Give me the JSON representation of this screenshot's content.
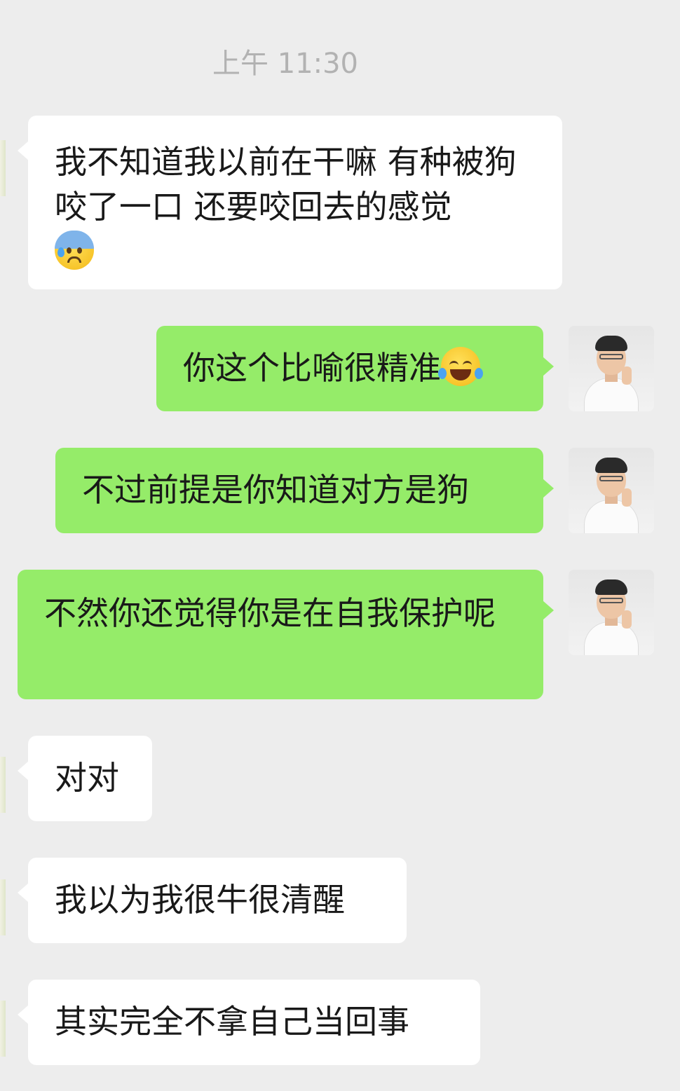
{
  "chat": {
    "timestamp": "上午 11:30",
    "messages": [
      {
        "side": "in",
        "text": "我不知道我以前在干嘛 有种被狗咬了一口 还要咬回去的感觉",
        "emoji": "anxious-face-with-sweat"
      },
      {
        "side": "out",
        "text": "你这个比喻很精准",
        "emoji": "face-with-tears-of-joy"
      },
      {
        "side": "out",
        "text": "不过前提是你知道对方是狗"
      },
      {
        "side": "out",
        "text": "不然你还觉得你是在自我保护呢"
      },
      {
        "side": "in",
        "text": "对对"
      },
      {
        "side": "in",
        "text": "我以为我很牛很清醒"
      },
      {
        "side": "in",
        "text": "其实完全不拿自己当回事"
      }
    ]
  },
  "colors": {
    "background": "#ededed",
    "incoming_bubble": "#ffffff",
    "outgoing_bubble": "#95ec69",
    "timestamp": "#b2b2b2"
  }
}
